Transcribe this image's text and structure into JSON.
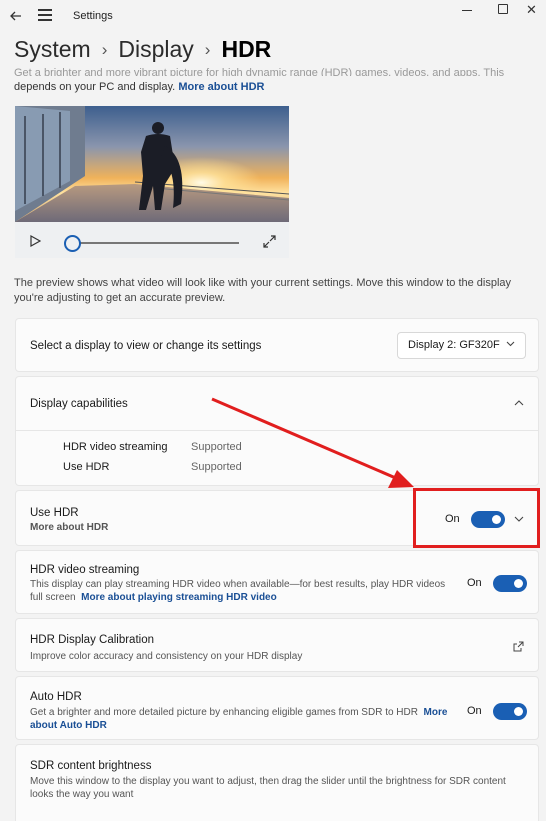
{
  "window": {
    "title": "Settings"
  },
  "breadcrumb": {
    "items": [
      "System",
      "Display"
    ],
    "current": "HDR"
  },
  "intro": {
    "faded_text": "Get a brighter and more vibrant picture for high dynamic range (HDR) games, videos, and apps. This",
    "text": "depends on your PC and display.",
    "link": "More about HDR"
  },
  "preview": {
    "note": "The preview shows what video will look like with your current settings. Move this window to the display you're adjusting to get an accurate preview.",
    "progress": 0
  },
  "display_select": {
    "label": "Select a display to view or change its settings",
    "value": "Display 2: GF320F"
  },
  "capabilities": {
    "title": "Display capabilities",
    "rows": [
      {
        "name": "HDR video streaming",
        "value": "Supported"
      },
      {
        "name": "Use HDR",
        "value": "Supported"
      }
    ]
  },
  "use_hdr": {
    "title": "Use HDR",
    "link": "More about HDR",
    "state": "On",
    "enabled": true
  },
  "hdr_streaming": {
    "title": "HDR video streaming",
    "desc": "This display can play streaming HDR video when available—for best results, play HDR videos",
    "desc2": "full screen",
    "link": "More about playing streaming HDR video",
    "state": "On",
    "enabled": true
  },
  "calibration": {
    "title": "HDR Display Calibration",
    "desc": "Improve color accuracy and consistency on your HDR display"
  },
  "auto_hdr": {
    "title": "Auto HDR",
    "desc": "Get a brighter and more detailed picture by enhancing eligible games from SDR to HDR",
    "link1": "More",
    "link2": "about Auto HDR",
    "state": "On",
    "enabled": true
  },
  "sdr": {
    "title": "SDR content brightness",
    "desc": "Move this window to the display you want to adjust, then drag the slider until the brightness for SDR content",
    "desc2": "looks the way you want"
  },
  "colors": {
    "accent": "#1a5fb4",
    "link": "#1a4f95",
    "annotation": "#e11e1e"
  }
}
